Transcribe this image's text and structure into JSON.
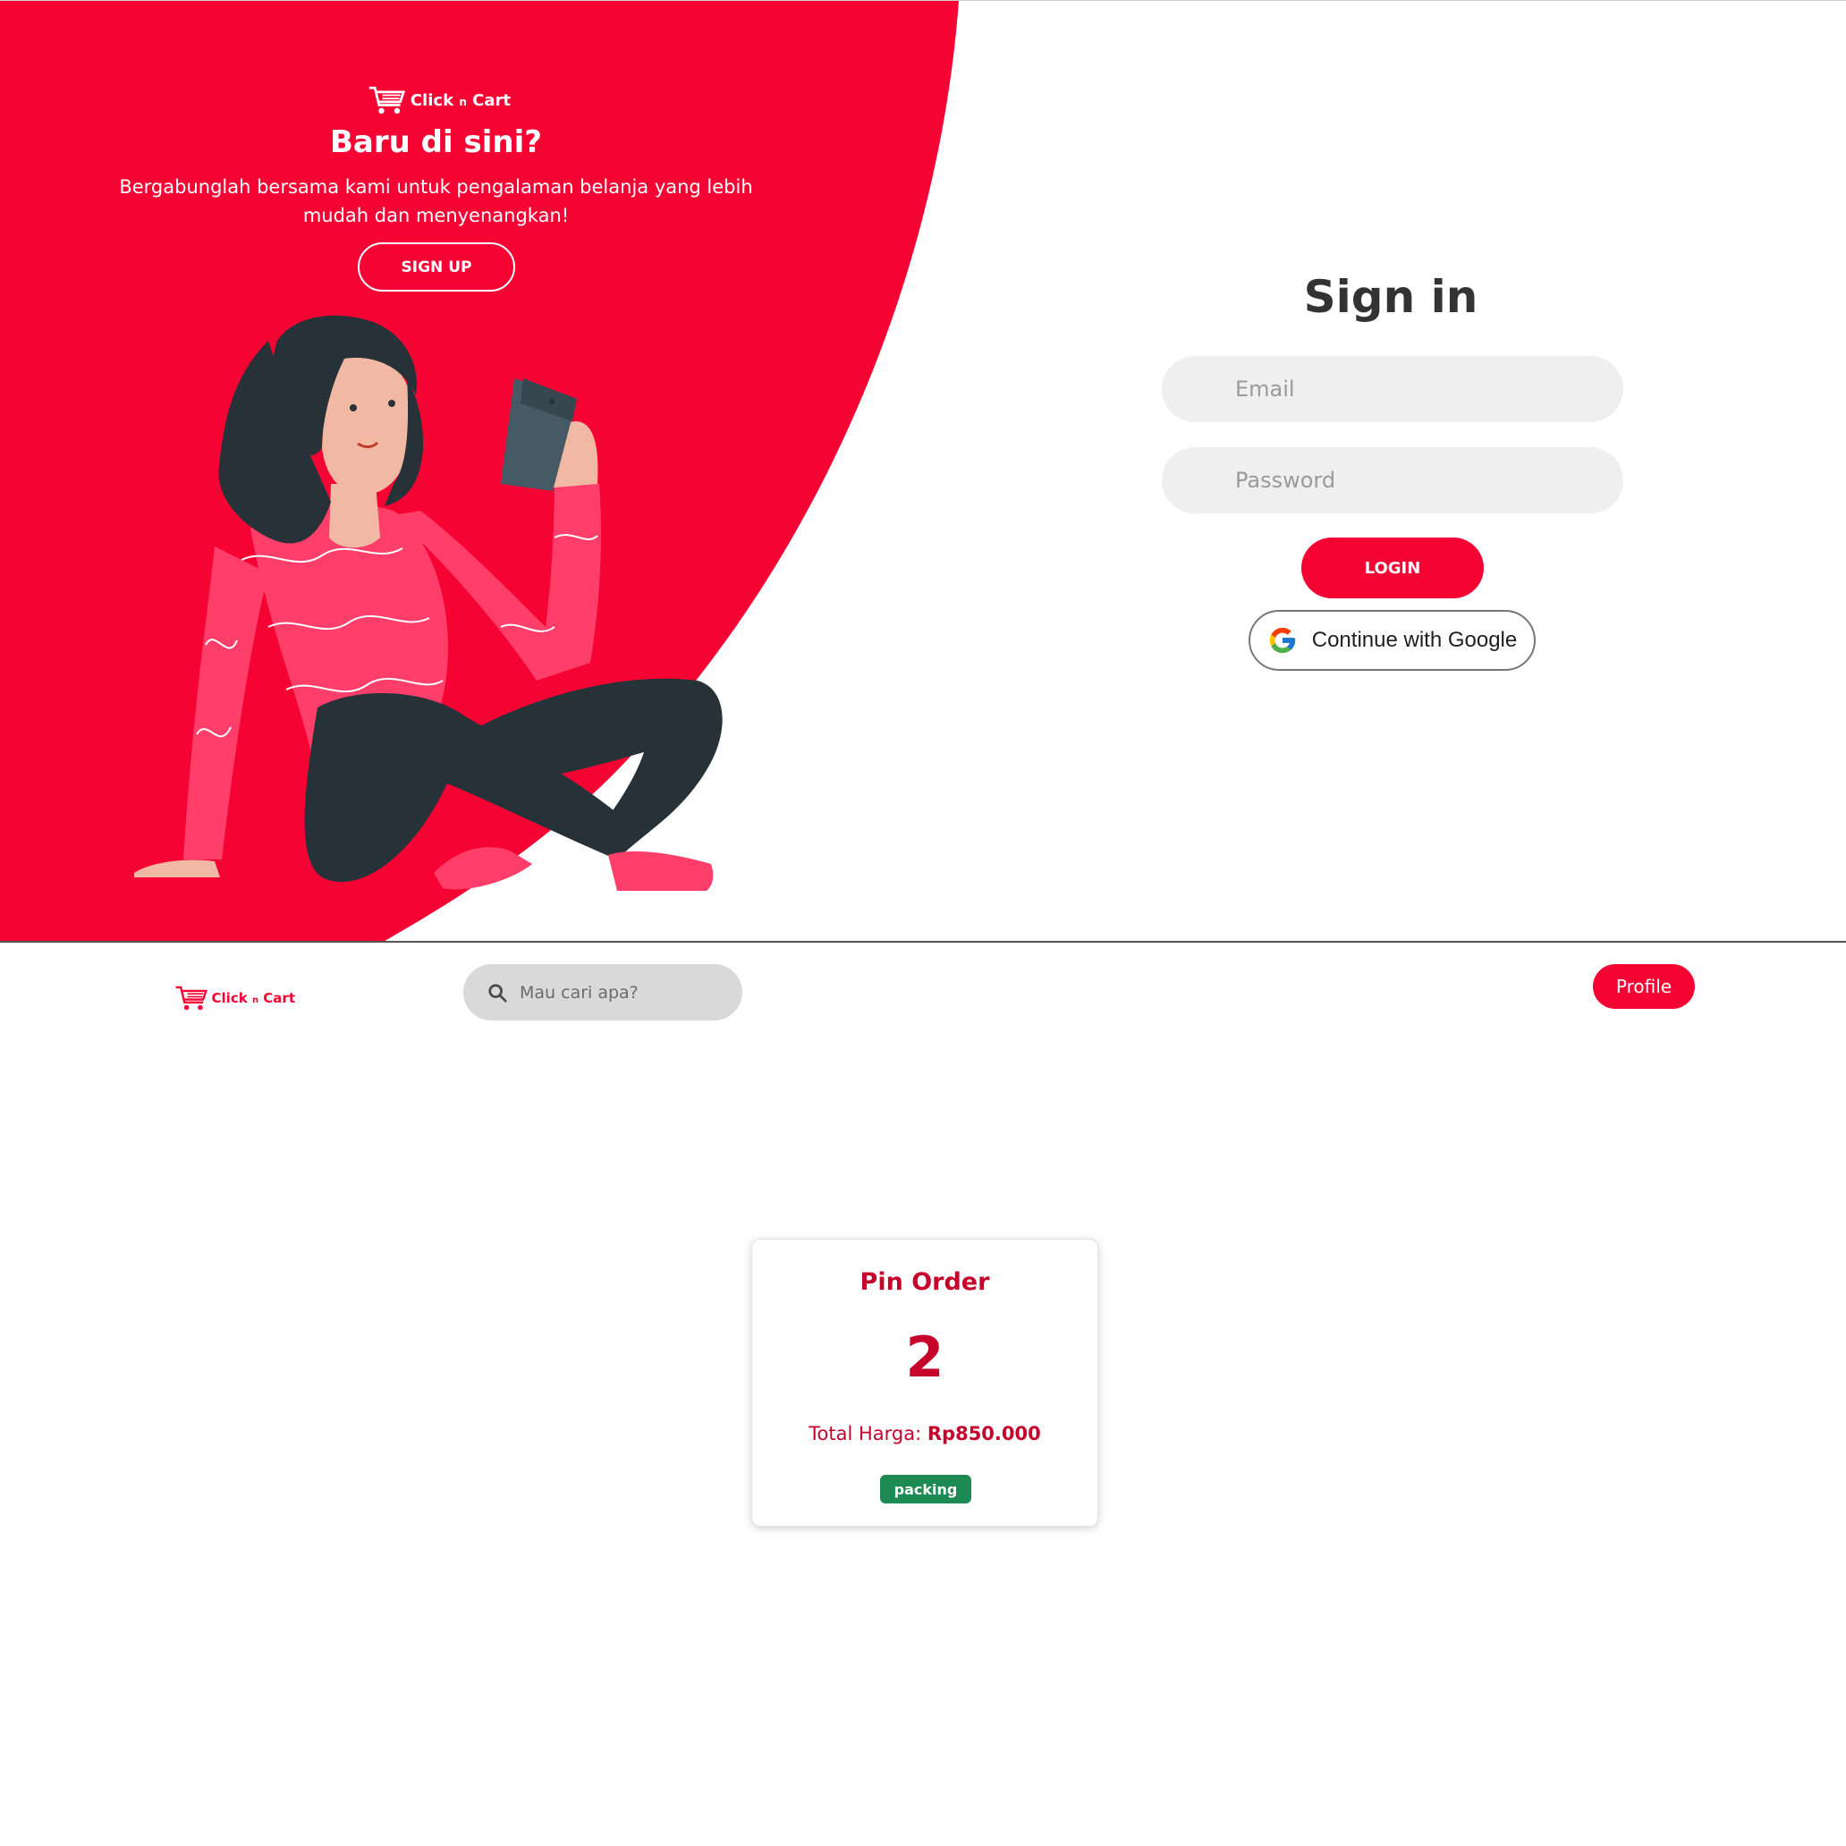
{
  "colors": {
    "brand_red": "#f50333",
    "dark_red_text": "#c5032b",
    "status_green": "#1e8a53",
    "input_bg": "#efefef"
  },
  "signin_page": {
    "logo": {
      "text_main": "Click",
      "text_small": "n",
      "text_end": "Cart",
      "icon": "cart-icon"
    },
    "left_panel": {
      "title": "Baru di sini?",
      "description": "Bergabunglah bersama kami untuk pengalaman belanja yang lebih mudah dan menyenangkan!",
      "signup_label": "SIGN UP"
    },
    "form": {
      "title": "Sign in",
      "email_placeholder": "Email",
      "password_placeholder": "Password",
      "login_label": "LOGIN",
      "google_label": "Continue with Google",
      "google_icon": "google-icon"
    }
  },
  "dashboard": {
    "logo": {
      "text_main": "Click",
      "text_small": "n",
      "text_end": "Cart",
      "icon": "cart-icon"
    },
    "search": {
      "placeholder": "Mau cari apa?",
      "icon": "search-icon"
    },
    "profile_label": "Profile",
    "order_card": {
      "title": "Pin Order",
      "count": "2",
      "total_label": "Total Harga:",
      "total_value": "Rp850.000",
      "status": "packing"
    }
  }
}
